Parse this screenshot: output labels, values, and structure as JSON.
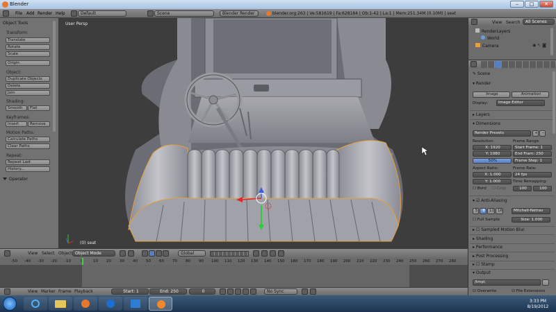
{
  "window": {
    "title": "Blender",
    "controls": [
      "–",
      "□",
      "✕"
    ]
  },
  "info_header": {
    "menus": [
      "File",
      "Add",
      "Render",
      "Help"
    ],
    "screen_layout": "Default",
    "scene": "Scene",
    "engine": "Blender Render",
    "stats": "blender.org 263 | Ve:581619 | Fa:628184 | Ob:1-42 | La:1 | Mem:251.34M (0.10M) | seat"
  },
  "tool_shelf": {
    "title": "Object Tools",
    "transform_label": "Transform:",
    "translate": "Translate",
    "rotate": "Rotate",
    "scale": "Scale",
    "origin": "Origin",
    "object_label": "Object:",
    "duplicate": "Duplicate Objects",
    "delete": "Delete",
    "join": "Join",
    "shading_label": "Shading:",
    "smooth": "Smooth",
    "flat": "Flat",
    "keyframes_label": "Keyframes:",
    "insert": "Insert",
    "remove": "Remove",
    "motion_paths_label": "Motion Paths:",
    "calculate_paths": "Calculate Paths",
    "clear_paths": "Clear Paths",
    "repeat_label": "Repeat:",
    "repeat_last": "Repeat Last",
    "history": "History...",
    "operator": "Operator"
  },
  "viewport": {
    "view_name": "User Persp",
    "object_name": "(0) seat"
  },
  "view3d_header": {
    "menus": [
      "View",
      "Select",
      "Object"
    ],
    "mode": "Object Mode",
    "orientation": "Global"
  },
  "timeline": {
    "ticks": [
      "-50",
      "-40",
      "-30",
      "-20",
      "-10",
      "0",
      "10",
      "20",
      "30",
      "40",
      "50",
      "60",
      "70",
      "80",
      "90",
      "100",
      "110",
      "120",
      "130",
      "140",
      "150",
      "160",
      "170",
      "180",
      "190",
      "200",
      "210",
      "220",
      "230",
      "240",
      "250",
      "260",
      "270",
      "280"
    ],
    "menus": [
      "View",
      "Marker",
      "Frame",
      "Playback"
    ],
    "start": "Start: 1",
    "end": "End: 250",
    "current": "0",
    "sync": "No Sync"
  },
  "outliner": {
    "menus": [
      "View",
      "Search"
    ],
    "filter": "All Scenes",
    "items": [
      "RenderLayers",
      "World",
      "Camera"
    ]
  },
  "properties": {
    "context": "Scene",
    "render_panel": "Render",
    "image_button": "Image",
    "animation_button": "Animation",
    "display_label": "Display:",
    "display_value": "Image Editor",
    "layers_panel": "Layers",
    "dimensions_panel": "Dimensions",
    "render_presets": "Render Presets",
    "resolution_label": "Resolution:",
    "res_x": "X: 1920",
    "res_y": "Y: 1080",
    "res_pct": "50%",
    "frame_range_label": "Frame Range:",
    "start_frame": "Start Frame: 1",
    "end_frame": "End Fram: 250",
    "frame_step": "Frame Step: 1",
    "aspect_label": "Aspect Ratio:",
    "aspect_x": "X: 1.000",
    "aspect_y": "Y: 1.000",
    "frame_rate_label": "Frame Rate:",
    "fps": "24 fps",
    "time_remap_label": "Time Remapping:",
    "remap_old": "100",
    "remap_new": "100",
    "bord": "Bord",
    "crop": "Crop",
    "aa_panel": "Anti-Aliasing",
    "aa_samples": [
      "5",
      "8",
      "11",
      "16"
    ],
    "aa_filter": "Mitchell-Netrav",
    "full_sample": "Full Sample",
    "size": "Size: 1.000",
    "motion_blur_panel": "Sampled Motion Blur",
    "shading_panel": "Shading",
    "performance_panel": "Performance",
    "post_processing_panel": "Post Processing",
    "stamp_panel": "Stamp",
    "output_panel": "Output",
    "output_path": "/tmp\\",
    "overwrite": "Overwrite",
    "file_extensions": "File Extensions"
  },
  "taskbar": {
    "time": "3:33 PM",
    "date": "8/19/2012"
  },
  "colors": {
    "accent_blue": "#5680c2",
    "selection_orange": "#e89f3c",
    "viewport_bg": "#3d3d3d",
    "panel_bg": "#727272"
  }
}
